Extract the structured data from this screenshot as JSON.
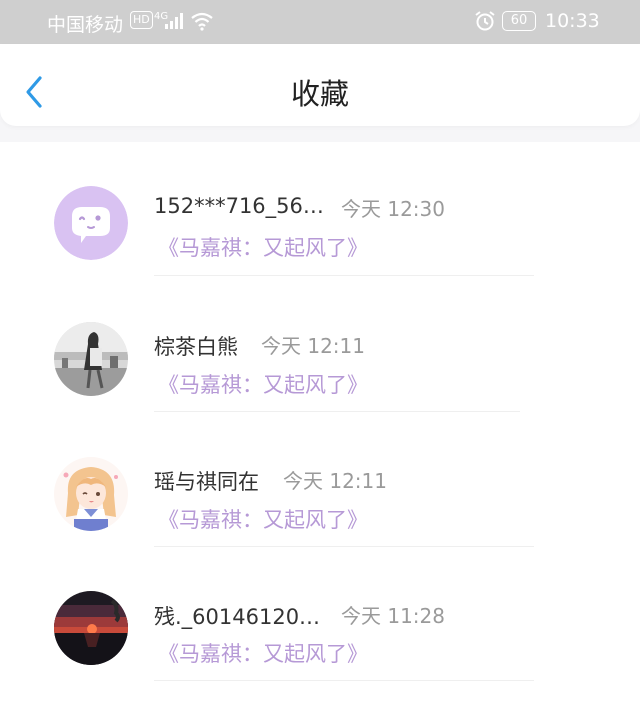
{
  "status_bar": {
    "carrier": "中国移动",
    "hd": "HD",
    "network": "4G",
    "battery": "60",
    "time": "10:33",
    "icons": [
      "signal-icon",
      "wifi-icon",
      "alarm-icon",
      "battery-icon"
    ]
  },
  "header": {
    "title": "收藏",
    "back_icon": "chevron-left-icon",
    "accent_color": "#2f9ae6"
  },
  "favorites": [
    {
      "username": "152***716_56…",
      "time": "今天 12:30",
      "book": "《马嘉祺：又起风了》",
      "avatar": "default-chat-avatar"
    },
    {
      "username": "棕茶白熊",
      "time": "今天 12:11",
      "book": "《马嘉祺：又起风了》",
      "avatar": "grayscale-photo-avatar"
    },
    {
      "username": "瑶与祺同在",
      "time": "今天 12:11",
      "book": "《马嘉祺：又起风了》",
      "avatar": "anime-girl-avatar"
    },
    {
      "username": "残._60146120…",
      "time": "今天 11:28",
      "book": "《马嘉祺：又起风了》",
      "avatar": "sunset-photo-avatar"
    }
  ],
  "colors": {
    "book_title": "#b699d6",
    "timestamp": "#9a9a9a",
    "status_bar_bg": "#cfcfcf"
  }
}
